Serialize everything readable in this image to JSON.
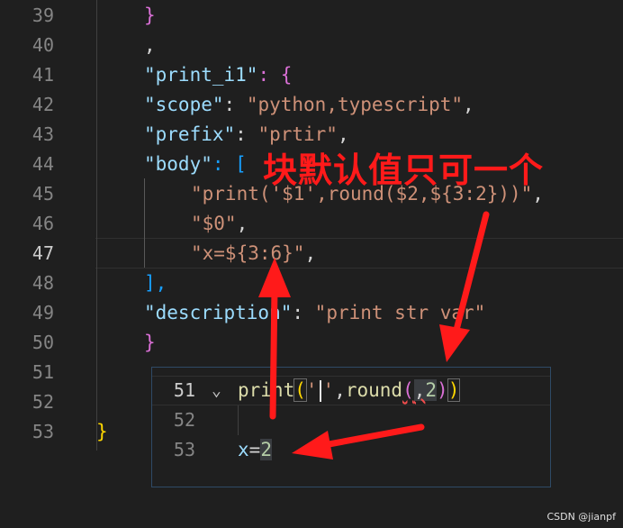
{
  "editor": {
    "lines": [
      {
        "num": "39",
        "text": "}"
      },
      {
        "num": "40",
        "text": ","
      },
      {
        "num": "41",
        "key": "\"print_i1\"",
        "rest": ": {"
      },
      {
        "num": "42",
        "key": "\"scope\"",
        "rest": ": ",
        "val": "\"python,typescript\"",
        "tail": ","
      },
      {
        "num": "43",
        "key": "\"prefix\"",
        "rest": ": ",
        "val": "\"prtir\"",
        "tail": ","
      },
      {
        "num": "44",
        "key": "\"body\"",
        "rest": ": ["
      },
      {
        "num": "45",
        "val": "\"print('$1',round($2,${3:2}))\"",
        "tail": ","
      },
      {
        "num": "46",
        "val": "\"$0\"",
        "tail": ","
      },
      {
        "num": "47",
        "val": "\"x=${3:6}\"",
        "tail": ","
      },
      {
        "num": "48",
        "text": "],"
      },
      {
        "num": "49",
        "key": "\"description\"",
        "rest": ": ",
        "val": "\"print str var\""
      },
      {
        "num": "50",
        "text": "}"
      },
      {
        "num": "51",
        "text": ""
      },
      {
        "num": "52",
        "text": ""
      },
      {
        "num": "53",
        "text": "}"
      }
    ]
  },
  "annotation": {
    "text": "块默认值只可一个",
    "color": "#ff1a1a"
  },
  "popup": {
    "lines": [
      {
        "num": "51",
        "func": "print",
        "open": "(",
        "str": "'",
        "str2": "'",
        "mid": ",",
        "func2": "round",
        "open2": "(",
        "comma": ",",
        "n": "2",
        "close2": ")",
        "close": ")"
      },
      {
        "num": "52"
      },
      {
        "num": "53",
        "var": "x",
        "eq": "=",
        "n": "2"
      }
    ]
  },
  "watermark": "CSDN @jianpf"
}
